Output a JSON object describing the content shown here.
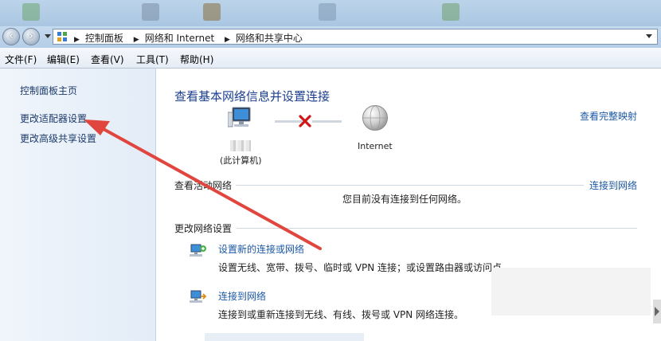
{
  "address_bar": {
    "crumbs": [
      "控制面板",
      "网络和 Internet",
      "网络和共享中心"
    ]
  },
  "menubar": [
    "文件(F)",
    "编辑(E)",
    "查看(V)",
    "工具(T)",
    "帮助(H)"
  ],
  "left_pane": {
    "links": [
      "控制面板主页",
      "更改适配器设置",
      "更改高级共享设置"
    ]
  },
  "main": {
    "title": "查看基本网络信息并设置连接",
    "full_map_link": "查看完整映射",
    "computer_label": "(此计算机)",
    "internet_label": "Internet",
    "active_networks_title": "查看活动网络",
    "connect_to_network_link": "连接到网络",
    "no_connection_text": "您目前没有连接到任何网络。",
    "change_settings_title": "更改网络设置",
    "tasks": [
      {
        "label": "设置新的连接或网络",
        "desc": "设置无线、宽带、拨号、临时或 VPN 连接；或设置路由器或访问点。"
      },
      {
        "label": "连接到网络",
        "desc": "连接到或重新连接到无线、有线、拨号或 VPN 网络连接。"
      }
    ]
  },
  "colors": {
    "link": "#1c58a6",
    "title": "#1c3f8f",
    "annotation_arrow": "#e0453e"
  }
}
